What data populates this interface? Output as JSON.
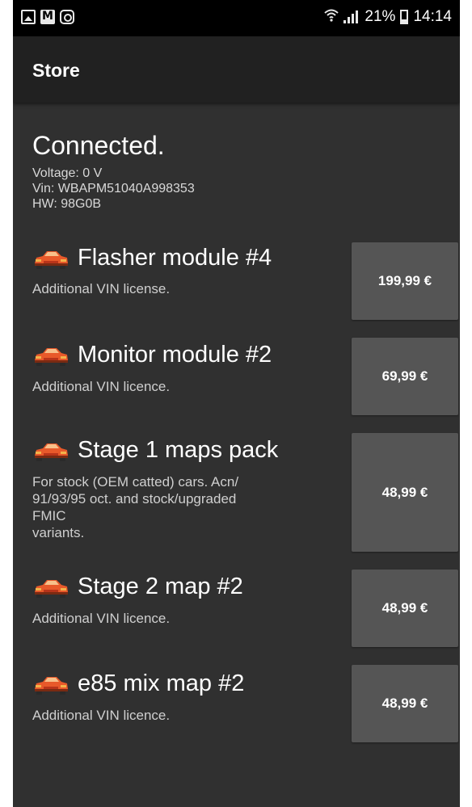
{
  "status_bar": {
    "left_icons": [
      "image-icon",
      "gmail-icon",
      "instagram-icon"
    ],
    "battery": "21%",
    "time": "14:14"
  },
  "app_bar": {
    "title": "Store"
  },
  "connection": {
    "status": "Connected.",
    "voltage": "Voltage: 0 V",
    "vin": "Vin: WBAPM51040A998353",
    "hw": "HW: 98G0B"
  },
  "items": [
    {
      "icon": "car-icon",
      "name": "Flasher module #4",
      "desc": "Additional VIN license.",
      "price": "199,99 €"
    },
    {
      "icon": "car-icon",
      "name": "Monitor module #2",
      "desc": "Additional VIN licence.",
      "price": "69,99 €"
    },
    {
      "icon": "car-icon",
      "name": "Stage 1 maps pack",
      "desc_lines": [
        "For stock (OEM catted) cars. Acn/",
        "91/93/95 oct. and stock/upgraded",
        "FMIC",
        "variants."
      ],
      "price": "48,99 €"
    },
    {
      "icon": "car-icon",
      "name": "Stage 2 map #2",
      "desc": "Additional VIN licence.",
      "price": "48,99 €"
    },
    {
      "icon": "car-icon",
      "name": "e85 mix map #2",
      "desc": "Additional VIN licence.",
      "price": "48,99 €"
    }
  ],
  "colors": {
    "background": "#303030",
    "app_bar": "#212121",
    "button": "#555555",
    "car_body": "#e8592a",
    "car_accent": "#f2b24a"
  }
}
